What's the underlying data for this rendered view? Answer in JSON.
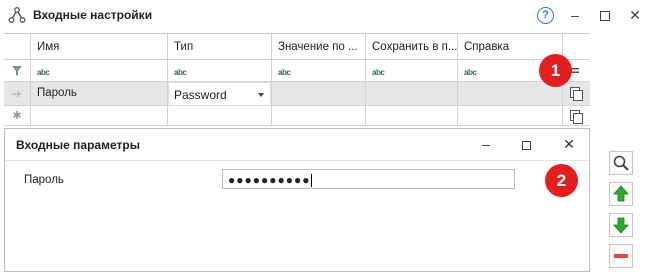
{
  "window": {
    "title": "Входные настройки",
    "help": "?"
  },
  "grid": {
    "columns": [
      "Имя",
      "Тип",
      "Значение по ...",
      "Сохранить в п...",
      "Справка"
    ],
    "filter_placeholder": "abc",
    "row": {
      "name": "Пароль",
      "type": "Password"
    }
  },
  "badges": {
    "one": "1",
    "two": "2"
  },
  "dialog": {
    "title": "Входные параметры",
    "field_label": "Пароль",
    "field_value": "●●●●●●●●●●"
  },
  "colors": {
    "badge": "#e31e1e",
    "arrow_up": "#2fa82f",
    "arrow_down": "#2fa82f",
    "remove": "#e04a3f",
    "help": "#2f7ad6"
  }
}
